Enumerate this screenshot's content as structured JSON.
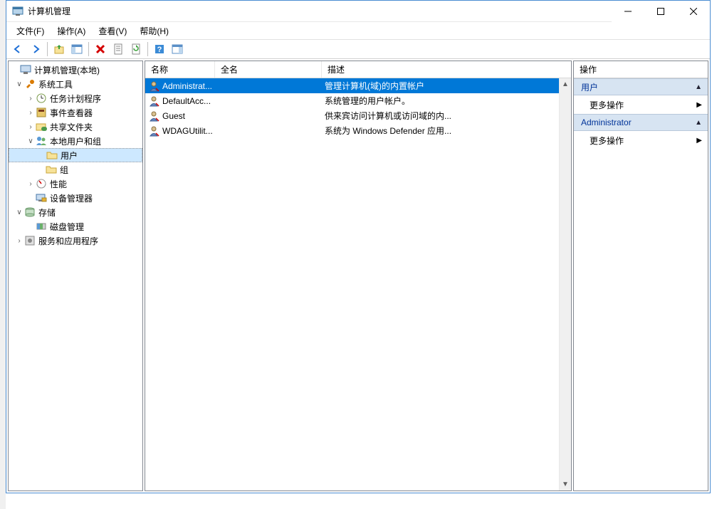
{
  "window": {
    "title": "计算机管理"
  },
  "menubar": [
    "文件(F)",
    "操作(A)",
    "查看(V)",
    "帮助(H)"
  ],
  "tree": {
    "root": "计算机管理(本地)",
    "sys_tools": "系统工具",
    "task_sched": "任务计划程序",
    "event_viewer": "事件查看器",
    "shared_folders": "共享文件夹",
    "local_users": "本地用户和组",
    "users": "用户",
    "groups": "组",
    "performance": "性能",
    "devmgr": "设备管理器",
    "storage": "存储",
    "diskmgmt": "磁盘管理",
    "services_apps": "服务和应用程序"
  },
  "list": {
    "headers": {
      "name": "名称",
      "fullname": "全名",
      "desc": "描述"
    },
    "rows": [
      {
        "name": "Administrat...",
        "full": "",
        "desc": "管理计算机(域)的内置帐户",
        "sel": true
      },
      {
        "name": "DefaultAcc...",
        "full": "",
        "desc": "系统管理的用户帐户。",
        "sel": false
      },
      {
        "name": "Guest",
        "full": "",
        "desc": "供来宾访问计算机或访问域的内...",
        "sel": false
      },
      {
        "name": "WDAGUtilit...",
        "full": "",
        "desc": "系统为 Windows Defender 应用...",
        "sel": false
      }
    ]
  },
  "actions": {
    "header": "操作",
    "section1": "用户",
    "item1": "更多操作",
    "section2": "Administrator",
    "item2": "更多操作"
  }
}
